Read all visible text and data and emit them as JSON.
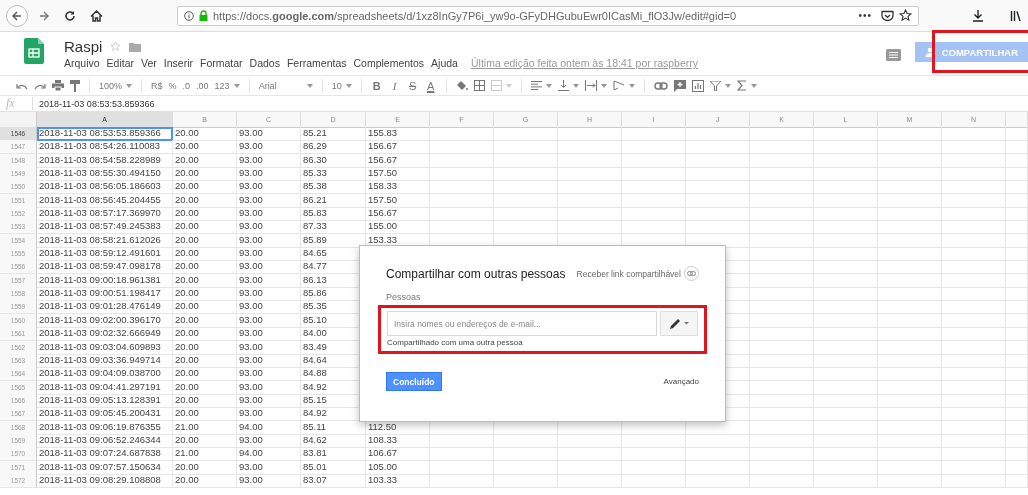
{
  "browser": {
    "url": "https://docs.**google.com**/spreadsheets/d/1xz8InGy7P6i_yw9o-GFyDHGubuEwr0ICasMi_flO3Jw/edit#gid=0",
    "more": "•••"
  },
  "doc": {
    "title": "Raspi",
    "menu": [
      "Arquivo",
      "Editar",
      "Ver",
      "Inserir",
      "Formatar",
      "Dados",
      "Ferramentas",
      "Complementos",
      "Ajuda"
    ],
    "last_edit": "Última edição feita ontem às 18:41 por raspberry",
    "share": "COMPARTILHAR"
  },
  "toolbar": {
    "zoom": "100%",
    "currency": "R$",
    "percent": "%",
    "decrease_decimals": ".0",
    "increase_decimals": ".00",
    "number_format": "123",
    "font": "Arial",
    "font_size": "10",
    "bold": "B",
    "italic": "I",
    "strikethrough": "S",
    "text_color": "A"
  },
  "formula": {
    "label": "fx",
    "value": "2018-11-03 08:53:53.859366"
  },
  "columns": [
    {
      "label": "A",
      "selected": true
    },
    {
      "label": "B",
      "selected": false
    },
    {
      "label": "C",
      "selected": false
    },
    {
      "label": "D",
      "selected": false
    },
    {
      "label": "E",
      "selected": false
    },
    {
      "label": "F",
      "selected": false
    },
    {
      "label": "G",
      "selected": false
    },
    {
      "label": "H",
      "selected": false
    },
    {
      "label": "I",
      "selected": false
    },
    {
      "label": "J",
      "selected": false
    },
    {
      "label": "K",
      "selected": false
    },
    {
      "label": "L",
      "selected": false
    },
    {
      "label": "M",
      "selected": false
    },
    {
      "label": "N",
      "selected": false
    }
  ],
  "rows": [
    {
      "num": "1546",
      "selected": true,
      "cells": [
        "2018-11-03 08:53:53.859366",
        "20.00",
        "93.00",
        "85.21",
        "155.83"
      ]
    },
    {
      "num": "1547",
      "selected": false,
      "cells": [
        "2018-11-03 08:54:26.110083",
        "20.00",
        "93.00",
        "86.29",
        "156.67"
      ]
    },
    {
      "num": "1548",
      "selected": false,
      "cells": [
        "2018-11-03 08:54:58.228989",
        "20.00",
        "93.00",
        "86.30",
        "156.67"
      ]
    },
    {
      "num": "1549",
      "selected": false,
      "cells": [
        "2018-11-03 08:55:30.494150",
        "20.00",
        "93.00",
        "85.33",
        "157.50"
      ]
    },
    {
      "num": "1550",
      "selected": false,
      "cells": [
        "2018-11-03 08:56:05.186603",
        "20.00",
        "93.00",
        "85.38",
        "158.33"
      ]
    },
    {
      "num": "1551",
      "selected": false,
      "cells": [
        "2018-11-03 08:56:45.204455",
        "20.00",
        "93.00",
        "86.21",
        "157.50"
      ]
    },
    {
      "num": "1552",
      "selected": false,
      "cells": [
        "2018-11-03 08:57:17.369970",
        "20.00",
        "93.00",
        "85.83",
        "156.67"
      ]
    },
    {
      "num": "1553",
      "selected": false,
      "cells": [
        "2018-11-03 08:57:49.245383",
        "20.00",
        "93.00",
        "87.33",
        "155.00"
      ]
    },
    {
      "num": "1554",
      "selected": false,
      "cells": [
        "2018-11-03 08:58:21.612026",
        "20.00",
        "93.00",
        "85.89",
        "153.33"
      ]
    },
    {
      "num": "1555",
      "selected": false,
      "cells": [
        "2018-11-03 08:59:12.491601",
        "20.00",
        "93.00",
        "84.65"
      ]
    },
    {
      "num": "1556",
      "selected": false,
      "cells": [
        "2018-11-03 08:59:47.098178",
        "20.00",
        "93.00",
        "84.77"
      ]
    },
    {
      "num": "1557",
      "selected": false,
      "cells": [
        "2018-11-03 09:00:18.961381",
        "20.00",
        "93.00",
        "86.13"
      ]
    },
    {
      "num": "1558",
      "selected": false,
      "cells": [
        "2018-11-03 09:00:51.198417",
        "20.00",
        "93.00",
        "85.86"
      ]
    },
    {
      "num": "1559",
      "selected": false,
      "cells": [
        "2018-11-03 09:01:28.476149",
        "20.00",
        "93.00",
        "85.35"
      ]
    },
    {
      "num": "1560",
      "selected": false,
      "cells": [
        "2018-11-03 09:02:00.396170",
        "20.00",
        "93.00",
        "85.10"
      ]
    },
    {
      "num": "1561",
      "selected": false,
      "cells": [
        "2018-11-03 09:02:32.666949",
        "20.00",
        "93.00",
        "84.00"
      ]
    },
    {
      "num": "1562",
      "selected": false,
      "cells": [
        "2018-11-03 09:03:04.609893",
        "20.00",
        "93.00",
        "83.49"
      ]
    },
    {
      "num": "1563",
      "selected": false,
      "cells": [
        "2018-11-03 09:03:36.949714",
        "20.00",
        "93.00",
        "84.64"
      ]
    },
    {
      "num": "1564",
      "selected": false,
      "cells": [
        "2018-11-03 09:04:09.038700",
        "20.00",
        "93.00",
        "84.88"
      ]
    },
    {
      "num": "1565",
      "selected": false,
      "cells": [
        "2018-11-03 09:04:41.297191",
        "20.00",
        "93.00",
        "84.92"
      ]
    },
    {
      "num": "1566",
      "selected": false,
      "cells": [
        "2018-11-03 09:05:13.128391",
        "20.00",
        "93.00",
        "85.15"
      ]
    },
    {
      "num": "1567",
      "selected": false,
      "cells": [
        "2018-11-03 09:05:45.200431",
        "20.00",
        "93.00",
        "84.92"
      ]
    },
    {
      "num": "1568",
      "selected": false,
      "cells": [
        "2018-11-03 09:06:19.876355",
        "21.00",
        "94.00",
        "85.11",
        "112.50"
      ]
    },
    {
      "num": "1569",
      "selected": false,
      "cells": [
        "2018-11-03 09:06:52.246344",
        "20.00",
        "93.00",
        "84.62",
        "108.33"
      ]
    },
    {
      "num": "1570",
      "selected": false,
      "cells": [
        "2018-11-03 09:07:24.687838",
        "21.00",
        "94.00",
        "83.81",
        "106.67"
      ]
    },
    {
      "num": "1571",
      "selected": false,
      "cells": [
        "2018-11-03 09:07:57.150634",
        "20.00",
        "93.00",
        "85.01",
        "105.00"
      ]
    },
    {
      "num": "1572",
      "selected": false,
      "cells": [
        "2018-11-03 09:08:29.108808",
        "20.00",
        "93.00",
        "83.07",
        "103.33"
      ]
    }
  ],
  "dialog": {
    "title": "Compartilhar com outras pessoas",
    "link": "Receber link compartilhável",
    "people_label": "Pessoas",
    "placeholder": "Insira nomes ou endereços de e-mail...",
    "shared_note": "Compartilhado com uma outra pessoa",
    "done": "Concluído",
    "advanced": "Avançado"
  }
}
